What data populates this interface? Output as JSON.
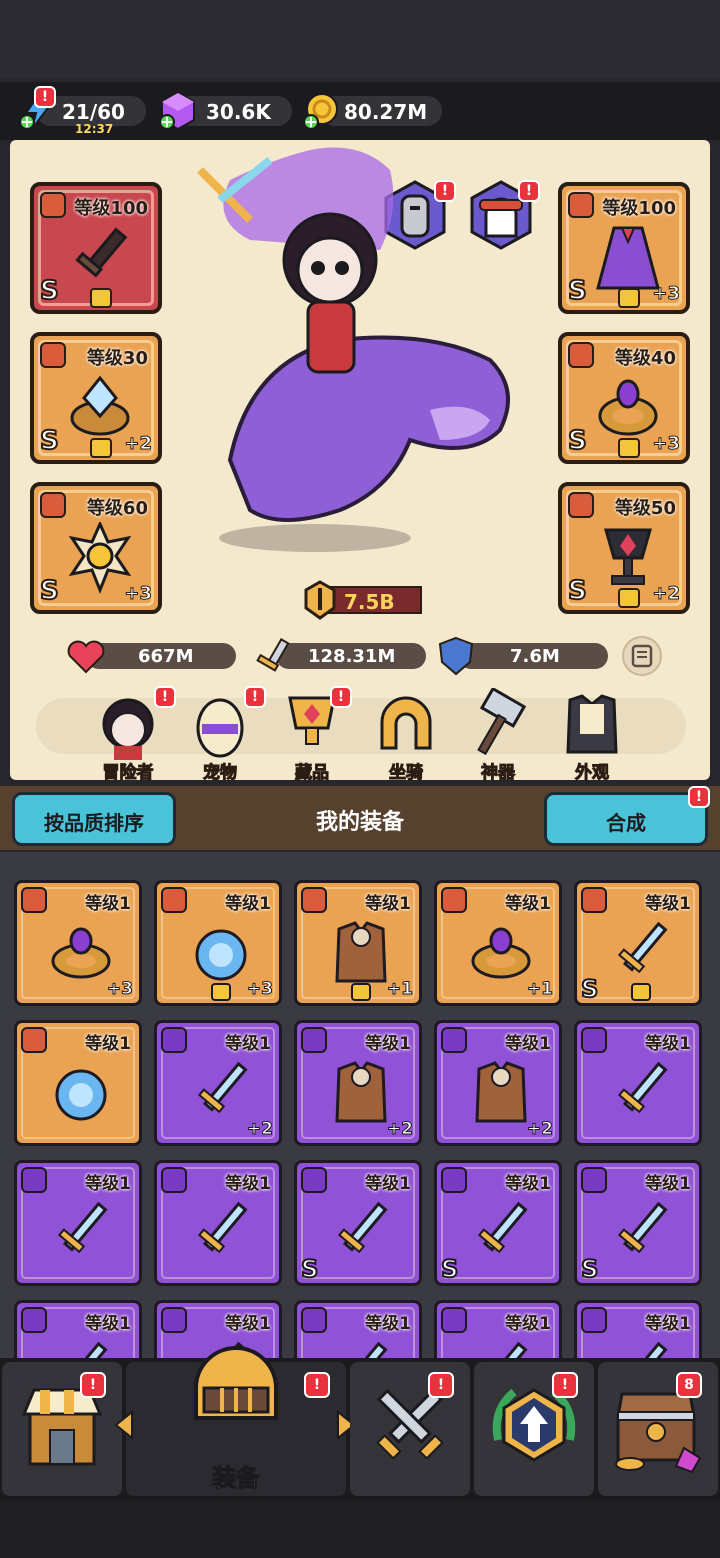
{
  "resources": {
    "energy": {
      "value": "21/60",
      "timer": "12:37",
      "icon": "lightning-icon"
    },
    "gems": {
      "value": "30.6K",
      "icon": "gem-icon"
    },
    "gold": {
      "value": "80.27M",
      "icon": "coin-icon"
    }
  },
  "hero_slots": [
    {
      "label": "等级100",
      "rarity": "S",
      "plus": "",
      "color": "red",
      "type": "weapon"
    },
    {
      "label": "等级30",
      "rarity": "S",
      "plus": "+2",
      "color": "orange",
      "type": "ring"
    },
    {
      "label": "等级60",
      "rarity": "S",
      "plus": "+3",
      "color": "orange",
      "type": "necklace"
    },
    {
      "label": "等级100",
      "rarity": "S",
      "plus": "+3",
      "color": "orange",
      "type": "armor"
    },
    {
      "label": "等级40",
      "rarity": "S",
      "plus": "+3",
      "color": "orange",
      "type": "ring"
    },
    {
      "label": "等级50",
      "rarity": "S",
      "plus": "+2",
      "color": "orange",
      "type": "necklace"
    }
  ],
  "power": "7.5B",
  "stats": {
    "hp": "667M",
    "attack": "128.31M",
    "defense": "7.6M"
  },
  "hero_tabs": [
    {
      "label": "冒险者",
      "badge": "!"
    },
    {
      "label": "宠物",
      "badge": "!"
    },
    {
      "label": "藏品",
      "badge": "!"
    },
    {
      "label": "坐骑",
      "badge": ""
    },
    {
      "label": "神器",
      "badge": ""
    },
    {
      "label": "外观",
      "badge": ""
    }
  ],
  "equipment_header": {
    "sort_label": "按品质排序",
    "title": "我的装备",
    "merge_label": "合成",
    "merge_badge": "!"
  },
  "equipment_items": [
    {
      "label": "等级1",
      "color": "orange",
      "plus": "+3",
      "rarity": "",
      "lock": false,
      "type": "ring"
    },
    {
      "label": "等级1",
      "color": "orange",
      "plus": "+3",
      "rarity": "",
      "lock": true,
      "type": "necklace"
    },
    {
      "label": "等级1",
      "color": "orange",
      "plus": "+1",
      "rarity": "",
      "lock": true,
      "type": "armor"
    },
    {
      "label": "等级1",
      "color": "orange",
      "plus": "+1",
      "rarity": "",
      "lock": false,
      "type": "ring"
    },
    {
      "label": "等级1",
      "color": "orange",
      "plus": "",
      "rarity": "S",
      "lock": true,
      "type": "weapon"
    },
    {
      "label": "等级1",
      "color": "orange",
      "plus": "",
      "rarity": "",
      "lock": false,
      "type": "necklace"
    },
    {
      "label": "等级1",
      "color": "purple",
      "plus": "+2",
      "rarity": "",
      "lock": false,
      "type": "weapon"
    },
    {
      "label": "等级1",
      "color": "purple",
      "plus": "+2",
      "rarity": "",
      "lock": false,
      "type": "armor"
    },
    {
      "label": "等级1",
      "color": "purple",
      "plus": "+2",
      "rarity": "",
      "lock": false,
      "type": "armor"
    },
    {
      "label": "等级1",
      "color": "purple",
      "plus": "",
      "rarity": "",
      "lock": false,
      "type": "weapon"
    },
    {
      "label": "等级1",
      "color": "purple",
      "plus": "",
      "rarity": "",
      "lock": false,
      "type": "weapon"
    },
    {
      "label": "等级1",
      "color": "purple",
      "plus": "",
      "rarity": "",
      "lock": false,
      "type": "weapon"
    },
    {
      "label": "等级1",
      "color": "purple",
      "plus": "",
      "rarity": "S",
      "lock": false,
      "type": "weapon"
    },
    {
      "label": "等级1",
      "color": "purple",
      "plus": "",
      "rarity": "S",
      "lock": false,
      "type": "weapon"
    },
    {
      "label": "等级1",
      "color": "purple",
      "plus": "",
      "rarity": "S",
      "lock": false,
      "type": "weapon"
    },
    {
      "label": "等级1",
      "color": "purple",
      "plus": "",
      "rarity": "",
      "lock": false,
      "type": "weapon"
    },
    {
      "label": "等级1",
      "color": "purple",
      "plus": "",
      "rarity": "",
      "lock": false,
      "type": "weapon"
    },
    {
      "label": "等级1",
      "color": "purple",
      "plus": "",
      "rarity": "",
      "lock": false,
      "type": "weapon"
    },
    {
      "label": "等级1",
      "color": "purple",
      "plus": "",
      "rarity": "",
      "lock": false,
      "type": "weapon"
    },
    {
      "label": "等级1",
      "color": "purple",
      "plus": "",
      "rarity": "",
      "lock": false,
      "type": "weapon"
    }
  ],
  "bottom_nav": [
    {
      "label": "",
      "icon": "shop-icon",
      "badge": "!"
    },
    {
      "label": "装备",
      "icon": "helmet-icon",
      "badge": "!"
    },
    {
      "label": "",
      "icon": "crossed-swords-icon",
      "badge": "!"
    },
    {
      "label": "",
      "icon": "upgrade-icon",
      "badge": "!"
    },
    {
      "label": "",
      "icon": "treasure-chest-icon",
      "badge": "8"
    }
  ],
  "colors": {
    "orange_slot": "#e9a353",
    "purple_slot": "#9052d6",
    "red_slot": "#c9474e",
    "button_blue": "#4ac3d8",
    "badge_red": "#e8333d"
  }
}
